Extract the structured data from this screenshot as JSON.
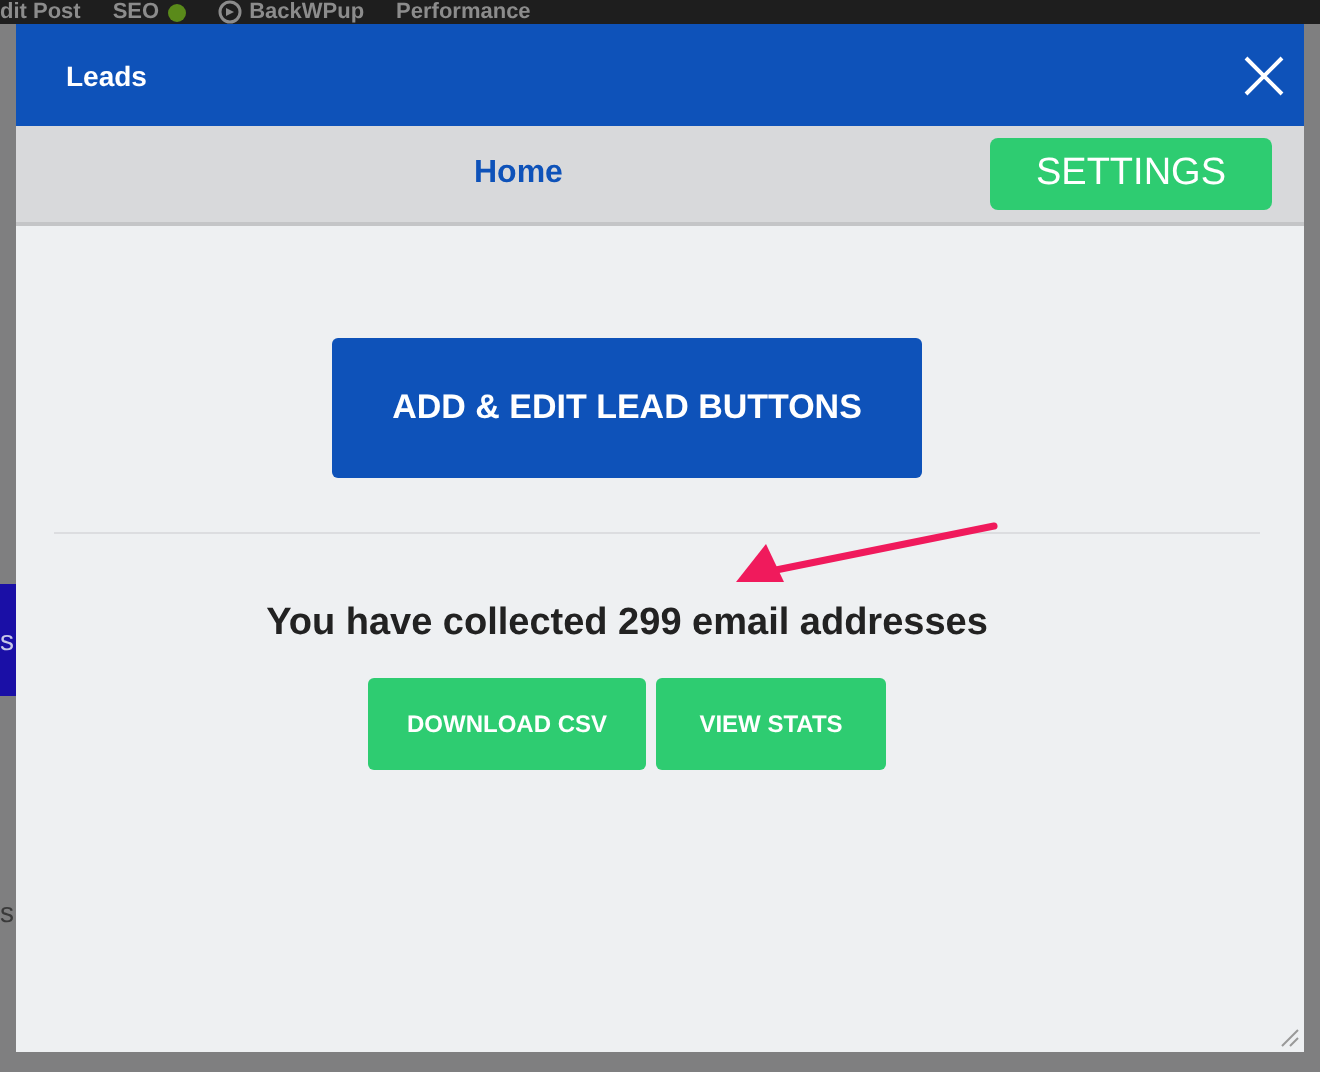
{
  "admin_bar": {
    "items": [
      {
        "label": "dit Post",
        "kind": "text"
      },
      {
        "label": "SEO",
        "kind": "status"
      },
      {
        "label": "BackWPup",
        "kind": "logo"
      },
      {
        "label": "Performance",
        "kind": "text"
      }
    ]
  },
  "background": {
    "fragments": [
      {
        "text": "s",
        "kind": "button"
      },
      {
        "text": "s",
        "kind": "text"
      }
    ]
  },
  "dialog": {
    "title": "Leads",
    "nav": {
      "items": [
        {
          "label": "Home",
          "kind": "link"
        },
        {
          "label": "SETTINGS",
          "kind": "button"
        }
      ]
    },
    "primary_button": "ADD & EDIT LEAD BUTTONS",
    "message": "You have collected 299 email addresses",
    "actions": [
      "DOWNLOAD CSV",
      "VIEW STATS"
    ]
  }
}
